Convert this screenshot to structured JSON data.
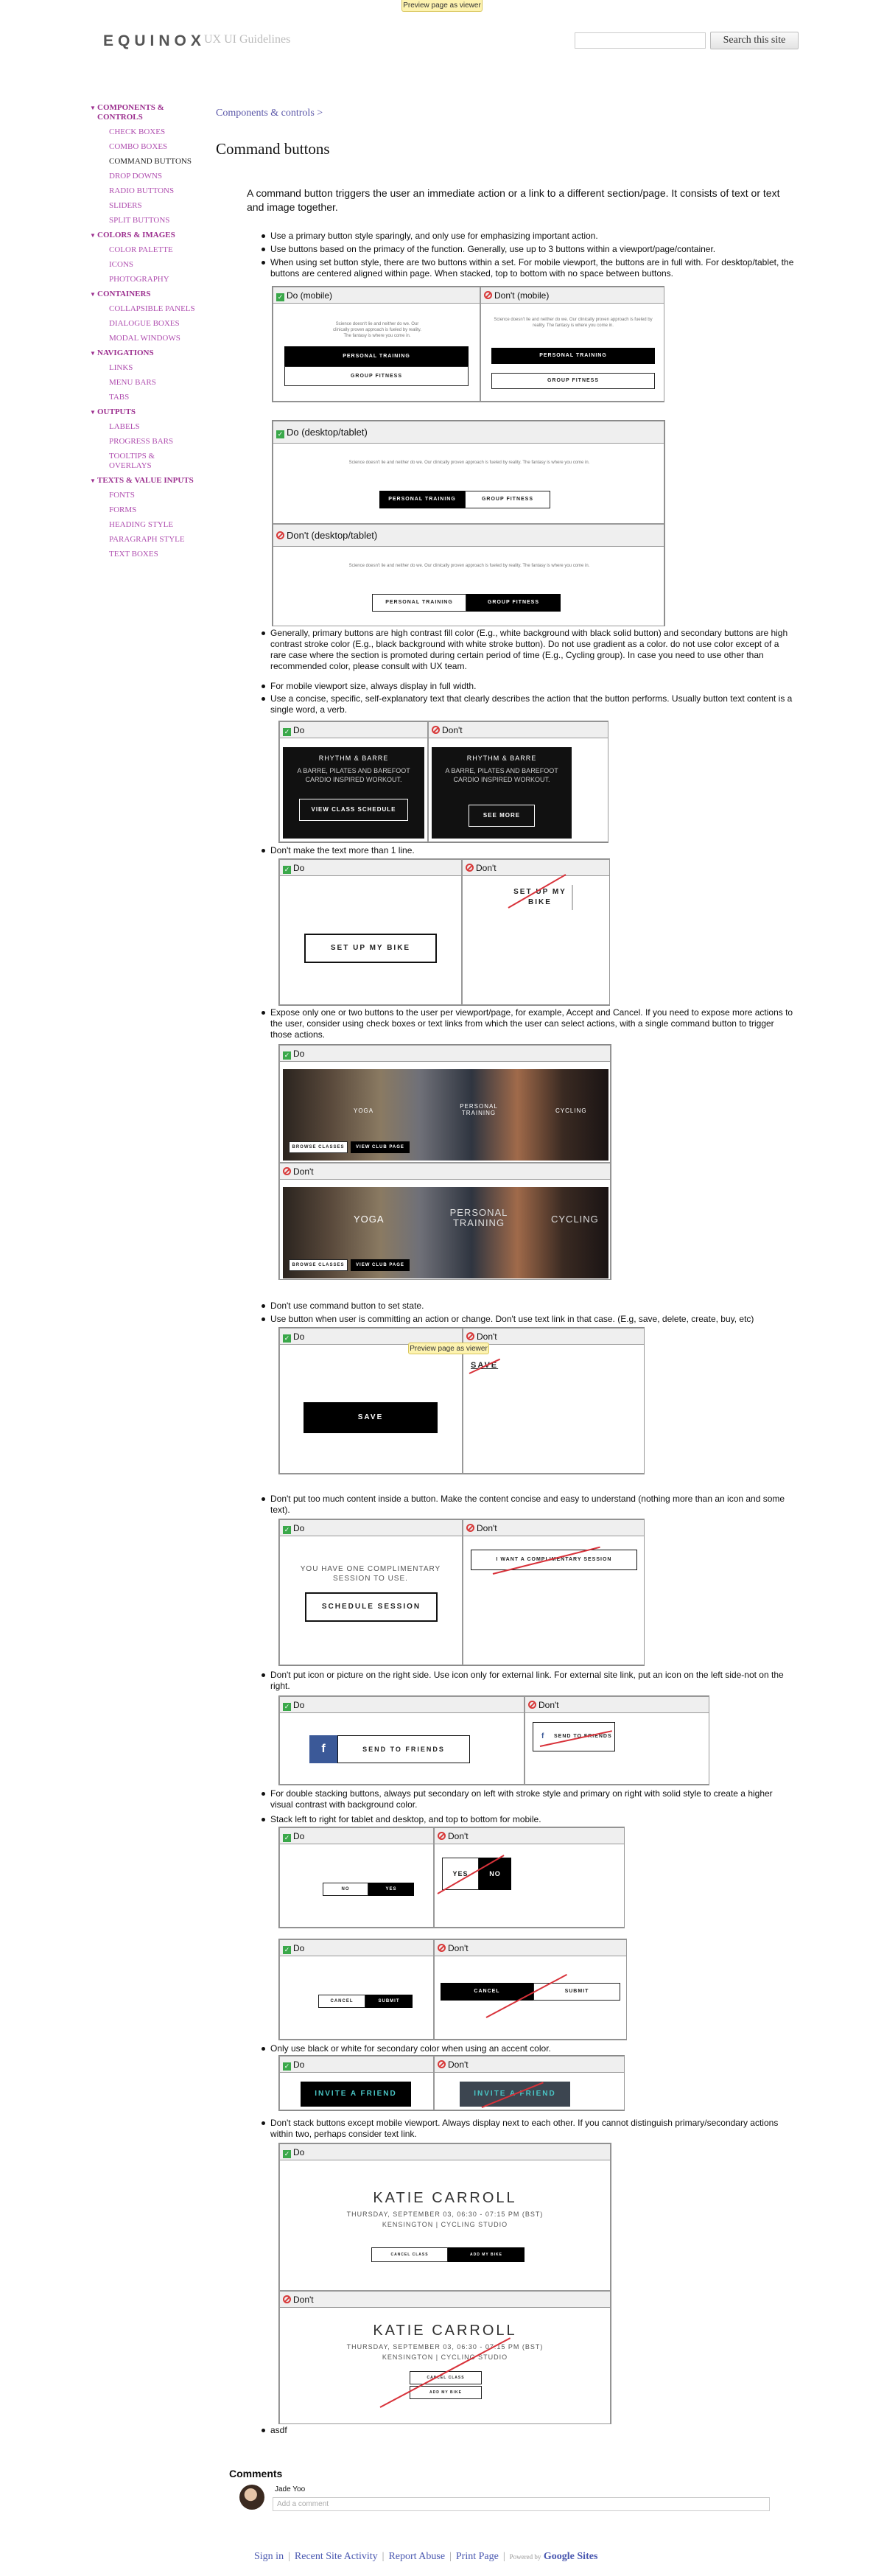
{
  "preview_banner": "Preview page as viewer",
  "header": {
    "logo": "EQUINOX",
    "subtitle": "UX UI Guidelines",
    "search_button": "Search this site"
  },
  "sidebar": {
    "items": [
      {
        "label": "COMPONENTS & CONTROLS",
        "type": "cat"
      },
      {
        "label": "CHECK BOXES",
        "type": "sub"
      },
      {
        "label": "COMBO BOXES",
        "type": "sub"
      },
      {
        "label": "COMMAND BUTTONS",
        "type": "cur"
      },
      {
        "label": "DROP DOWNS",
        "type": "sub"
      },
      {
        "label": "RADIO BUTTONS",
        "type": "sub"
      },
      {
        "label": "SLIDERS",
        "type": "sub"
      },
      {
        "label": "SPLIT BUTTONS",
        "type": "sub"
      },
      {
        "label": "COLORS & IMAGES",
        "type": "cat"
      },
      {
        "label": "COLOR PALETTE",
        "type": "sub"
      },
      {
        "label": "ICONS",
        "type": "sub"
      },
      {
        "label": "PHOTOGRAPHY",
        "type": "sub"
      },
      {
        "label": "CONTAINERS",
        "type": "cat"
      },
      {
        "label": "COLLAPSIBLE PANELS",
        "type": "sub"
      },
      {
        "label": "DIALOGUE BOXES",
        "type": "sub"
      },
      {
        "label": "MODAL WINDOWS",
        "type": "sub"
      },
      {
        "label": "NAVIGATIONS",
        "type": "cat"
      },
      {
        "label": "LINKS",
        "type": "sub"
      },
      {
        "label": "MENU BARS",
        "type": "sub"
      },
      {
        "label": "TABS",
        "type": "sub"
      },
      {
        "label": "OUTPUTS",
        "type": "cat"
      },
      {
        "label": "LABELS",
        "type": "sub"
      },
      {
        "label": "PROGRESS BARS",
        "type": "sub"
      },
      {
        "label": "TOOLTIPS & OVERLAYS",
        "type": "sub"
      },
      {
        "label": "TEXTS & VALUE INPUTS",
        "type": "cat"
      },
      {
        "label": "FONTS",
        "type": "sub"
      },
      {
        "label": "FORMS",
        "type": "sub"
      },
      {
        "label": "HEADING STYLE",
        "type": "sub"
      },
      {
        "label": "PARAGRAPH STYLE",
        "type": "sub"
      },
      {
        "label": "TEXT BOXES",
        "type": "sub"
      }
    ]
  },
  "breadcrumb": "Components & controls >",
  "title": "Command buttons",
  "intro": "A command button triggers the user an immediate action or a link to a different section/page. It consists of text or text and image together.",
  "bullets": {
    "b1": "Use a primary button style sparingly, and only use for emphasizing important action.",
    "b2": "Use buttons based on the primacy of the function. Generally, use up to 3 buttons within a viewport/page/container.",
    "b3": "When using set button style, there are two buttons within a set. For mobile viewport, the buttons are in full with. For desktop/tablet, the buttons are centered aligned within page. When stacked, top to bottom with no space between buttons.",
    "b4": "Generally, primary buttons are high contrast fill color (E.g., white background with black solid button) and secondary buttons are high contrast stroke color (E.g., black background with white stroke button). Do not use gradient as a color. do not use color except of a rare case where the section is promoted during certain period of time (E.g., Cycling group). In case you need to use other than recommended color, please consult with UX team.",
    "b5": "For mobile viewport size, always display in full width.",
    "b6": "Use a concise, specific, self-explanatory text that clearly describes the action that the button performs. Usually button text content is a single word, a verb.",
    "b7": "Don't make the text more than 1 line.",
    "b8": "Expose only one or two buttons to the user per viewport/page, for example, Accept and Cancel. If you need to expose more actions to the user, consider using check boxes or text links from which the user can select actions, with a single command button to trigger those actions.",
    "b9": "Don't use command button to set state.",
    "b10": "Use button when user is committing an action or change. Don't use text link in that case. (E.g, save, delete, create, buy, etc)",
    "b11": "Don't put too much content inside a button. Make the content concise and easy to understand (nothing more than an icon and some text).",
    "b12": "Don't put icon or picture on the right side. Use icon only for external link. For external site link, put an icon on the left side-not on the right.",
    "b13": "For double stacking buttons, always put secondary on left with stroke style and primary on right with solid style to create a higher visual contrast with background color.",
    "b14": "Stack left to right for tablet and desktop, and top to bottom for mobile.",
    "b15": "Only use black or white for secondary color when using an accent color.",
    "b16": "Don't stack buttons except mobile viewport. Always display next to each other. If you cannot distinguish primary/secondary actions within two, perhaps consider text link.",
    "b17": "asdf"
  },
  "labels": {
    "do": "Do",
    "dont": "Don't",
    "do_mobile": "Do (mobile)",
    "dont_mobile": "Don't (mobile)",
    "do_desktop": "Do (desktop/tablet)",
    "dont_desktop": "Don't (desktop/tablet)"
  },
  "examples": {
    "sample_text": "Science doesn't lie and neither do we. Our clinically proven approach is fueled by reality. The fantasy is where you come in.",
    "personal_training": "PERSONAL TRAINING",
    "group_fitness": "GROUP FITNESS",
    "rhythm_title": "RHYTHM & BARRE",
    "rhythm_sub": "A BARRE, PILATES AND BAREFOOT CARDIO INSPIRED WORKOUT.",
    "view_class": "VIEW CLASS SCHEDULE",
    "see_more": "SEE MORE",
    "setup_bike": "SET UP MY BIKE",
    "setup_bike_wrap": "SET UP MY BIKE",
    "yoga": "YOGA",
    "personal": "PERSONAL TRAINING",
    "cycling": "CYCLING",
    "browse": "BROWSE CLASSES",
    "view_club": "VIEW CLUB PAGE",
    "save": "SAVE",
    "complimentary": "YOU HAVE ONE COMPLIMENTARY SESSION TO USE.",
    "schedule": "SCHEDULE SESSION",
    "want_complimentary": "I WANT A COMPLIMENTARY SESSION",
    "send": "SEND TO FRIENDS",
    "no": "NO",
    "yes": "YES",
    "cancel": "CANCEL",
    "submit": "SUBMIT",
    "invite": "INVITE A FRIEND",
    "katie": "KATIE CARROLL",
    "date": "THURSDAY, SEPTEMBER 03, 06:30 - 07:15 PM (BST)",
    "studio": "KENSINGTON | CYCLING STUDIO",
    "cancel_class": "CANCEL CLASS",
    "add_my_bike": "ADD MY BIKE"
  },
  "comments": {
    "title": "Comments",
    "author": "Jade Yoo",
    "placeholder": "Add a comment"
  },
  "footer": {
    "sign_in": "Sign in",
    "recent": "Recent Site Activity",
    "report": "Report Abuse",
    "print": "Print Page",
    "powered": "Powered by",
    "google": "Google Sites"
  },
  "colors": {
    "brand_purple": "#9c2f8f",
    "link_blue": "#4a58b0",
    "accent_teal": "#49c5c5",
    "facebook": "#3b5998",
    "do_green": "#3aa84a",
    "dont_red": "#d83a3a"
  }
}
